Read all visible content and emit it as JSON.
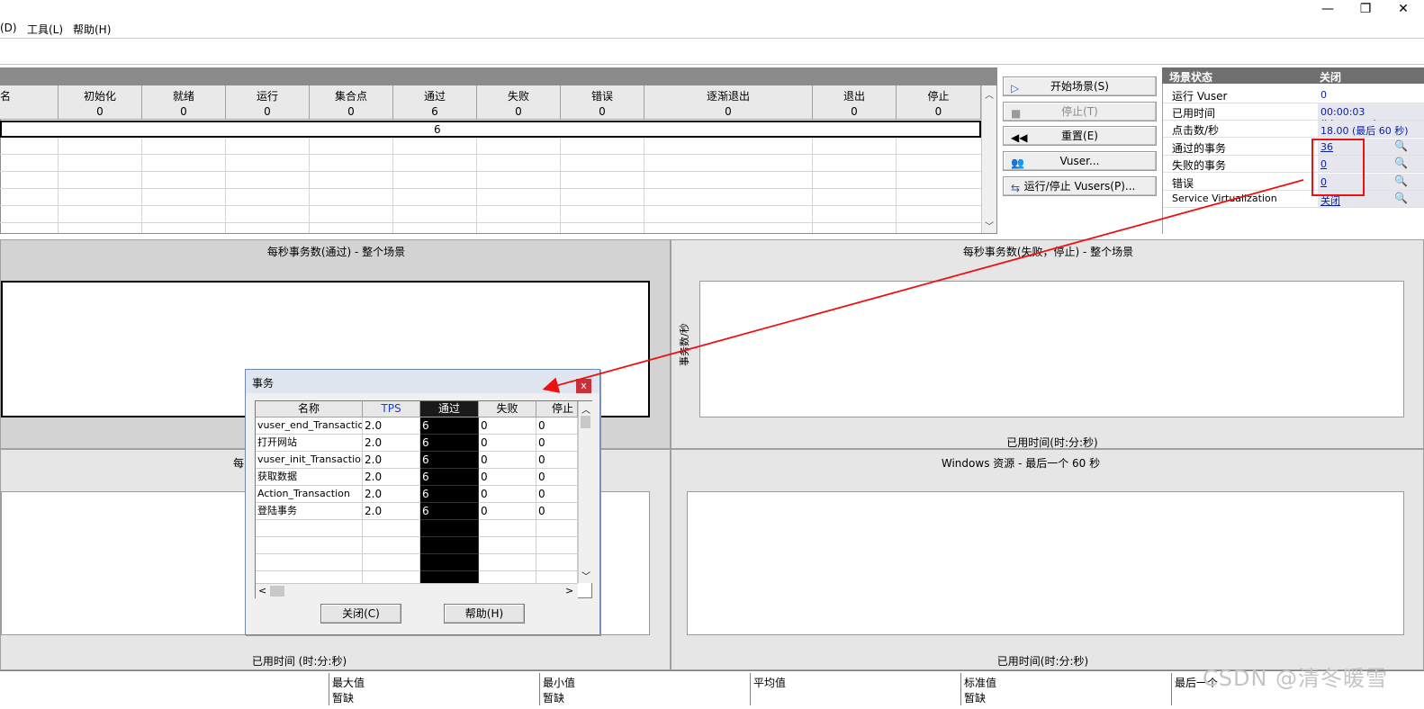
{
  "window": {
    "minimize": "—",
    "restore": "❐",
    "close": "✕"
  },
  "menu": {
    "items": [
      "(D)",
      "工具(L)",
      "帮助(H)"
    ]
  },
  "groups": {
    "columns": [
      {
        "title": "名",
        "value": ""
      },
      {
        "title": "初始化",
        "value": "0"
      },
      {
        "title": "就绪",
        "value": "0"
      },
      {
        "title": "运行",
        "value": "0"
      },
      {
        "title": "集合点",
        "value": "0"
      },
      {
        "title": "通过",
        "value": "6"
      },
      {
        "title": "失败",
        "value": "0"
      },
      {
        "title": "错误",
        "value": "0"
      },
      {
        "title": "逐渐退出",
        "value": "0"
      },
      {
        "title": "退出",
        "value": "0"
      },
      {
        "title": "停止",
        "value": "0"
      }
    ],
    "selected_row_passed": "6"
  },
  "actions": {
    "start": "开始场景(S)",
    "stop": "停止(T)",
    "reset": "重置(E)",
    "vusers": "Vuser...",
    "run_stop": "运行/停止 Vusers(P)..."
  },
  "status": {
    "header": "场景状态",
    "header_value": "关闭",
    "rows": [
      {
        "label": "运行 Vuser",
        "value": "0"
      },
      {
        "label": "已用时间",
        "value": "00:00:03 (hh:mm:ss)"
      },
      {
        "label": "点击数/秒",
        "value": "18.00 (最后 60 秒)"
      },
      {
        "label": "通过的事务",
        "value": "36"
      },
      {
        "label": "失败的事务",
        "value": "0"
      },
      {
        "label": "错误",
        "value": "0"
      },
      {
        "label": "Service Virtualization",
        "value": "关闭"
      }
    ]
  },
  "graphs": {
    "tps_pass_title": "每秒事务数(通过) - 整个场景",
    "tps_fail_title": "每秒事务数(失败，停止) - 整个场景",
    "tps_fail_ylabel": "事务数/秒",
    "tps_fail_xlabel": "已用时间(时:分:秒)",
    "lower_left_title": "每",
    "lower_left_xlabel": "已用时间 (时:分:秒)",
    "windows_title": "Windows 资源 - 最后一个 60 秒",
    "windows_xlabel": "已用时间(时:分:秒)"
  },
  "legend": {
    "columns": [
      {
        "head": "最大值",
        "data": "暂缺"
      },
      {
        "head": "最小值",
        "data": "暂缺"
      },
      {
        "head": "平均值",
        "data": ""
      },
      {
        "head": "标准值",
        "data": "暂缺"
      },
      {
        "head": "最后一个",
        "data": ""
      }
    ]
  },
  "watermark": "CSDN @清冬暖雪",
  "dialog": {
    "title": "事务",
    "close_x": "x",
    "headers": [
      "名称",
      "TPS",
      "通过",
      "失败",
      "停止"
    ],
    "rows": [
      [
        "vuser_end_Transaction",
        "2.0",
        "6",
        "0",
        "0"
      ],
      [
        "打开网站",
        "2.0",
        "6",
        "0",
        "0"
      ],
      [
        "vuser_init_Transaction",
        "2.0",
        "6",
        "0",
        "0"
      ],
      [
        "获取数据",
        "2.0",
        "6",
        "0",
        "0"
      ],
      [
        "Action_Transaction",
        "2.0",
        "6",
        "0",
        "0"
      ],
      [
        "登陆事务",
        "2.0",
        "6",
        "0",
        "0"
      ]
    ],
    "close_button": "关闭(C)",
    "help_button": "帮助(H)"
  },
  "colors": {
    "annotation": "#ee1111",
    "link": "#0a1ea0",
    "tps_header": "#1a3fd0"
  }
}
